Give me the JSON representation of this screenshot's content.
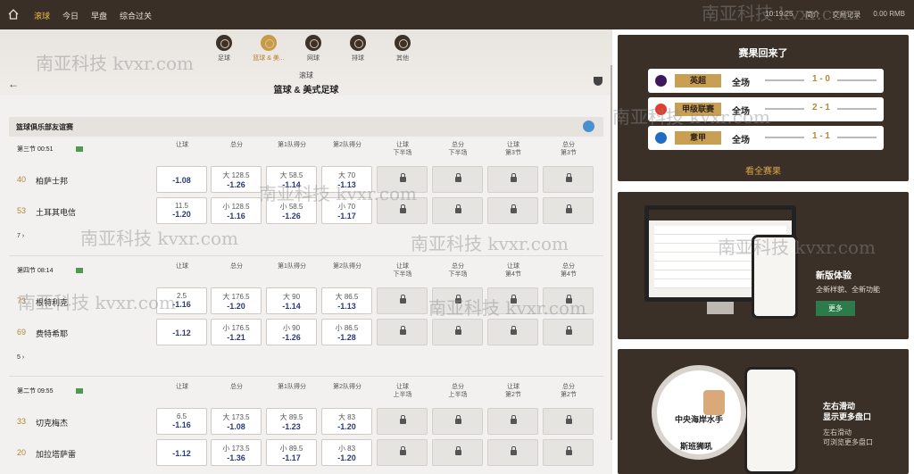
{
  "topbar": {
    "nav": [
      "滚球",
      "今日",
      "早盘",
      "综合过关"
    ],
    "time": "10:19:25",
    "right_items": [
      "简介",
      "交易记录",
      "0.00 RMB"
    ]
  },
  "sports": [
    {
      "label": "足球"
    },
    {
      "label": "篮球 & 美..."
    },
    {
      "label": "网球"
    },
    {
      "label": "排球"
    },
    {
      "label": "其他"
    }
  ],
  "title": {
    "line1": "滚球",
    "line2": "篮球 & 美式足球"
  },
  "league": {
    "name": "篮球俱乐部友谊赛"
  },
  "matches": [
    {
      "period": "第三节 00:51",
      "headers": [
        "让球",
        "总分",
        "第1队得分",
        "第2队得分",
        "让球\n下半场",
        "总分\n下半场",
        "让球\n第3节",
        "总分\n第3节"
      ],
      "teams": [
        {
          "num": "40",
          "name": "柏萨士邦",
          "odds": [
            {
              "l1": "",
              "l2": "-1.08"
            },
            {
              "l1": "大 128.5",
              "l2": "-1.26"
            },
            {
              "l1": "大 58.5",
              "l2": "-1.14"
            },
            {
              "l1": "大 70",
              "l2": "-1.13"
            }
          ]
        },
        {
          "num": "53",
          "name": "土耳其电信",
          "odds": [
            {
              "l1": "11.5",
              "l2": "-1.20"
            },
            {
              "l1": "小 128.5",
              "l2": "-1.16"
            },
            {
              "l1": "小 58.5",
              "l2": "-1.26"
            },
            {
              "l1": "小 70",
              "l2": "-1.17"
            }
          ]
        }
      ],
      "more": "7 ›"
    },
    {
      "period": "第四节 08:14",
      "headers": [
        "让球",
        "总分",
        "第1队得分",
        "第2队得分",
        "让球\n下半场",
        "总分\n下半场",
        "让球\n第4节",
        "总分\n第4节"
      ],
      "teams": [
        {
          "num": "73",
          "name": "根特利克",
          "odds": [
            {
              "l1": "2.5",
              "l2": "-1.16"
            },
            {
              "l1": "大 176.5",
              "l2": "-1.20"
            },
            {
              "l1": "大 90",
              "l2": "-1.14"
            },
            {
              "l1": "大 86.5",
              "l2": "-1.13"
            }
          ]
        },
        {
          "num": "69",
          "name": "费特希耶",
          "odds": [
            {
              "l1": "",
              "l2": "-1.12"
            },
            {
              "l1": "小 176.5",
              "l2": "-1.21"
            },
            {
              "l1": "小 90",
              "l2": "-1.26"
            },
            {
              "l1": "小 86.5",
              "l2": "-1.28"
            }
          ]
        }
      ],
      "more": "5 ›"
    },
    {
      "period": "第二节 09:55",
      "headers": [
        "让球",
        "总分",
        "第1队得分",
        "第2队得分",
        "让球\n上半场",
        "总分\n上半场",
        "让球\n第2节",
        "总分\n第2节"
      ],
      "teams": [
        {
          "num": "33",
          "name": "切克梅杰",
          "odds": [
            {
              "l1": "6.5",
              "l2": "-1.16"
            },
            {
              "l1": "大 173.5",
              "l2": "-1.08"
            },
            {
              "l1": "大 89.5",
              "l2": "-1.23"
            },
            {
              "l1": "大 83",
              "l2": "-1.20"
            }
          ]
        },
        {
          "num": "20",
          "name": "加拉塔萨雷",
          "odds": [
            {
              "l1": "",
              "l2": "-1.12"
            },
            {
              "l1": "小 173.5",
              "l2": "-1.36"
            },
            {
              "l1": "小 89.5",
              "l2": "-1.17"
            },
            {
              "l1": "小 83",
              "l2": "-1.20"
            }
          ]
        }
      ],
      "more": ""
    }
  ],
  "results": {
    "title": "赛果回来了",
    "items": [
      {
        "league": "英超",
        "label": "全场",
        "score": "1 - 0",
        "color": "#3d195b"
      },
      {
        "league": "甲级联赛",
        "label": "全场",
        "score": "2 - 1",
        "color": "#e03c31"
      },
      {
        "league": "意甲",
        "label": "全场",
        "score": "1 - 1",
        "color": "#1d6ec2"
      }
    ],
    "all": "看全赛果"
  },
  "promo1": {
    "title": "新版体验",
    "subtitle": "全新样貌、全新功能",
    "button": "更多"
  },
  "promo2": {
    "title1": "左右滑动",
    "title2": "显示更多盘口",
    "sub1": "左右滑动",
    "sub2": "可浏览更多盘口",
    "circle_team1": "中央海岸水手",
    "circle_team2": "斯班狮吼"
  },
  "watermark": "南亚科技 kvxr.com"
}
